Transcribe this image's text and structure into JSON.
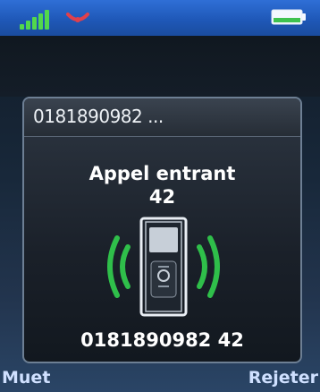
{
  "status_bar": {
    "signal_icon": "signal-bars-icon",
    "ring_icon": "ringer-icon",
    "battery_icon": "battery-icon",
    "signal_color": "#52d84c",
    "ring_color": "#e0404c"
  },
  "call": {
    "caller_number_top": "0181890982 ...",
    "status": "Appel entrant",
    "line": "42",
    "caller_number_bottom": "0181890982 42",
    "phone_icon": "ringing-phone-icon",
    "wave_color": "#2fbf4a"
  },
  "softkeys": {
    "left_label": "Muet",
    "right_label": "Rejeter"
  }
}
